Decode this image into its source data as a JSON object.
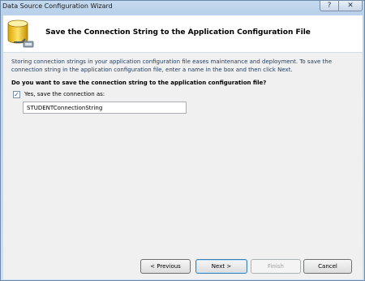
{
  "window": {
    "title": "Data Source Configuration Wizard",
    "help_glyph": "?",
    "close_glyph": "✕"
  },
  "header": {
    "icon": "database-connection-icon",
    "title": "Save the Connection String to the Application Configuration File"
  },
  "content": {
    "description": "Storing connection strings in your application configuration file eases maintenance and deployment. To save the connection string in the application configuration file, enter a name in the box and then click Next.",
    "question": "Do you want to save the connection string to the application configuration file?",
    "save_checkbox": {
      "label": "Yes, save the connection as:",
      "checked": true,
      "glyph": "✓"
    },
    "connection_name": "STUDENTConnectionString"
  },
  "buttons": {
    "previous": "< Previous",
    "next": "Next >",
    "finish": "Finish",
    "finish_enabled": false,
    "cancel": "Cancel"
  }
}
